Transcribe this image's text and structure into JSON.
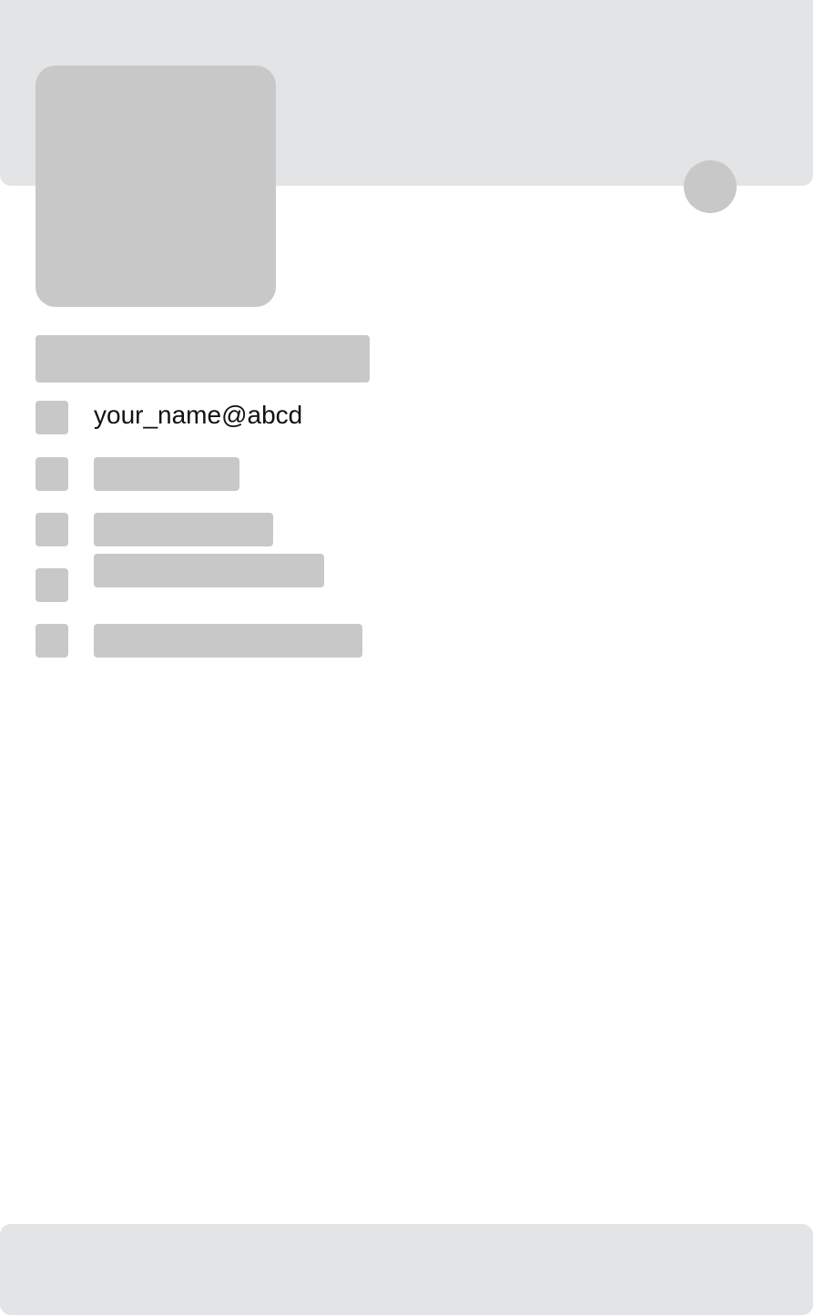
{
  "profile": {
    "email": "your_name@abcd"
  },
  "colors": {
    "header_background": "#e3e4e6",
    "placeholder": "#c8c8c8",
    "text": "#111111",
    "page_background": "#ffffff"
  },
  "icons": {
    "avatar": "avatar-placeholder",
    "edit": "edit-icon",
    "info_rows": [
      "email-icon",
      "info-icon",
      "info-icon",
      "info-icon",
      "info-icon"
    ]
  }
}
